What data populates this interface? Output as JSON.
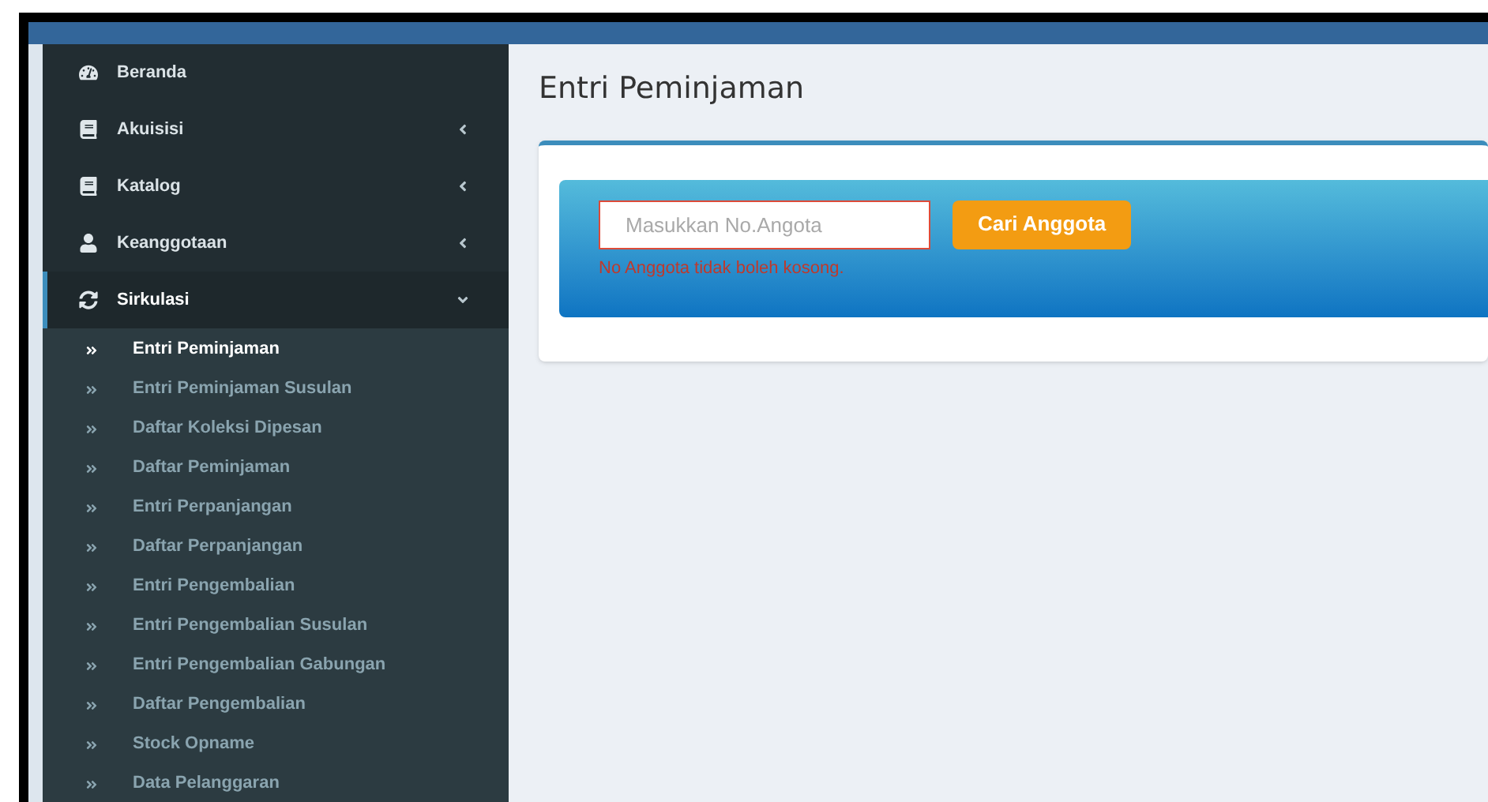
{
  "sidebar": {
    "items": [
      {
        "label": "Beranda",
        "kind": "dashboard",
        "selected": false
      },
      {
        "label": "Akuisisi",
        "kind": "book",
        "expanded": false,
        "selected": false
      },
      {
        "label": "Katalog",
        "kind": "book",
        "expanded": false,
        "selected": false
      },
      {
        "label": "Keanggotaan",
        "kind": "user",
        "expanded": false,
        "selected": false
      },
      {
        "label": "Sirkulasi",
        "kind": "refresh",
        "expanded": true,
        "selected": true,
        "children": [
          {
            "label": "Entri Peminjaman",
            "selected": true
          },
          {
            "label": "Entri Peminjaman Susulan",
            "selected": false
          },
          {
            "label": "Daftar Koleksi Dipesan",
            "selected": false
          },
          {
            "label": "Daftar Peminjaman",
            "selected": false
          },
          {
            "label": "Entri Perpanjangan",
            "selected": false
          },
          {
            "label": "Daftar Perpanjangan",
            "selected": false
          },
          {
            "label": "Entri Pengembalian",
            "selected": false
          },
          {
            "label": "Entri Pengembalian Susulan",
            "selected": false
          },
          {
            "label": "Entri Pengembalian Gabungan",
            "selected": false
          },
          {
            "label": "Daftar Pengembalian",
            "selected": false
          },
          {
            "label": "Stock Opname",
            "selected": false
          },
          {
            "label": "Data Pelanggaran",
            "selected": false
          }
        ]
      }
    ]
  },
  "page_title": "Entri Peminjaman",
  "search": {
    "placeholder": "Masukkan No.Angota",
    "error": "No Anggota tidak boleh kosong.",
    "button": "Cari Anggota"
  }
}
